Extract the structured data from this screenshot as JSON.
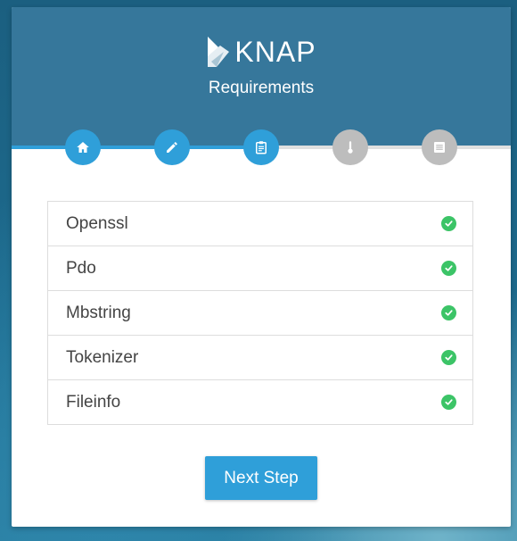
{
  "header": {
    "logo_text": "KNAP",
    "logo_icon": "knap-logo-mark",
    "subtitle": "Requirements"
  },
  "steps": [
    {
      "icon": "home-icon",
      "state": "active"
    },
    {
      "icon": "pencil-icon",
      "state": "active"
    },
    {
      "icon": "clipboard-icon",
      "state": "active"
    },
    {
      "icon": "thermometer-icon",
      "state": "inactive"
    },
    {
      "icon": "list-icon",
      "state": "inactive"
    }
  ],
  "progress": 0.5,
  "requirements": [
    {
      "name": "Openssl",
      "status": "ok"
    },
    {
      "name": "Pdo",
      "status": "ok"
    },
    {
      "name": "Mbstring",
      "status": "ok"
    },
    {
      "name": "Tokenizer",
      "status": "ok"
    },
    {
      "name": "Fileinfo",
      "status": "ok"
    }
  ],
  "actions": {
    "next_label": "Next Step"
  },
  "colors": {
    "header_bg": "#36779b",
    "accent": "#2f9fd9",
    "inactive_step": "#bdbdbd",
    "success": "#3cc467"
  }
}
